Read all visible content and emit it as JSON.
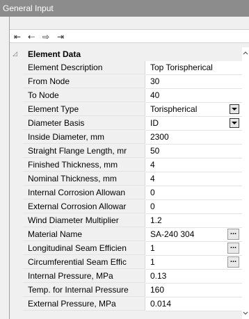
{
  "window": {
    "title": "General Input"
  },
  "toolbar": {
    "buttons": [
      {
        "icon": "⇤",
        "name": "first-icon"
      },
      {
        "icon": "⇠",
        "name": "prev-icon"
      },
      {
        "icon": "⇨",
        "name": "next-icon"
      },
      {
        "icon": "⇥",
        "name": "last-icon"
      }
    ]
  },
  "category": {
    "label": "Element Data",
    "toggle": "◿"
  },
  "scroll": {
    "up": "⌃",
    "down": "⌄"
  },
  "rows": [
    {
      "label": "Element Description",
      "value": "Top Torispherical",
      "control": ""
    },
    {
      "label": "From Node",
      "value": "30",
      "control": ""
    },
    {
      "label": "To Node",
      "value": "40",
      "control": ""
    },
    {
      "label": "Element Type",
      "value": "Torispherical",
      "control": "dropdown"
    },
    {
      "label": "Diameter Basis",
      "value": "ID",
      "control": "dropdown"
    },
    {
      "label": "Inside Diameter, mm",
      "value": "2300",
      "control": ""
    },
    {
      "label": "Straight Flange Length, mr",
      "value": "50",
      "control": ""
    },
    {
      "label": "Finished Thickness, mm",
      "value": "4",
      "control": ""
    },
    {
      "label": "Nominal Thickness, mm",
      "value": "4",
      "control": ""
    },
    {
      "label": "Internal Corrosion Allowan",
      "value": "0",
      "control": ""
    },
    {
      "label": "External Corrosion Allowar",
      "value": "0",
      "control": ""
    },
    {
      "label": "Wind Diameter Multiplier",
      "value": "1.2",
      "control": ""
    },
    {
      "label": "Material Name",
      "value": "SA-240 304",
      "control": "ellipsis"
    },
    {
      "label": "Longitudinal Seam Efficien",
      "value": "1",
      "control": "ellipsis"
    },
    {
      "label": "Circumferential Seam Effic",
      "value": "1",
      "control": "ellipsis"
    },
    {
      "label": "Internal Pressure, MPa",
      "value": "0.13",
      "control": ""
    },
    {
      "label": "Temp. for Internal Pressure",
      "value": "160",
      "control": ""
    },
    {
      "label": "External Pressure, MPa",
      "value": "0.014",
      "control": ""
    }
  ],
  "ellipsis_label": "...",
  "colors": {
    "titlebar": "#8c8c8c",
    "frame": "#f0f0f0",
    "value_bg": "#ffffff"
  }
}
